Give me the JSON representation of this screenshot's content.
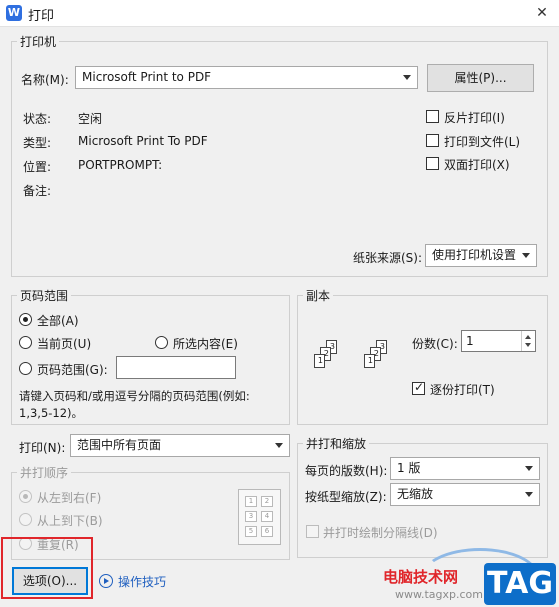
{
  "window": {
    "title": "打印",
    "app_icon": "wps-writer-icon"
  },
  "printer": {
    "group_label": "打印机",
    "name_label": "名称(M):",
    "name_value": "Microsoft Print to PDF",
    "properties_button": "属性(P)...",
    "status_label": "状态:",
    "status_value": "空闲",
    "type_label": "类型:",
    "type_value": "Microsoft Print To PDF",
    "location_label": "位置:",
    "location_value": "PORTPROMPT:",
    "comment_label": "备注:",
    "reverse_print": {
      "label": "反片打印(I)",
      "checked": false
    },
    "print_to_file": {
      "label": "打印到文件(L)",
      "checked": false
    },
    "duplex_print": {
      "label": "双面打印(X)",
      "checked": false
    },
    "paper_source_label": "纸张来源(S):",
    "paper_source_value": "使用打印机设置"
  },
  "page_range": {
    "group_label": "页码范围",
    "all_label": "全部(A)",
    "current_label": "当前页(U)",
    "selection_label": "所选内容(E)",
    "range_label": "页码范围(G):",
    "range_value": "",
    "selected": "all",
    "hint": "请键入页码和/或用逗号分隔的页码范围(例如:",
    "hint_line2": "1,3,5-12)。"
  },
  "copies": {
    "group_label": "副本",
    "count_label": "份数(C):",
    "count_value": "1",
    "collate_label": "逐份打印(T)",
    "collate_checked": true
  },
  "print_what": {
    "label": "打印(N):",
    "value": "范围中所有页面"
  },
  "combine_order": {
    "group_label": "并打顺序",
    "left_to_right": "从左到右(F)",
    "top_to_bottom": "从上到下(B)",
    "repeat": "重复(R)",
    "grid_numbers": [
      "1",
      "2",
      "3",
      "4",
      "5",
      "6"
    ]
  },
  "scale": {
    "group_label": "并打和缩放",
    "pages_per_sheet_label": "每页的版数(H):",
    "pages_per_sheet_value": "1 版",
    "scale_to_paper_label": "按纸型缩放(Z):",
    "scale_to_paper_value": "无缩放",
    "draw_borders_label": "并打时绘制分隔线(D)"
  },
  "footer": {
    "options_button": "选项(O)...",
    "tips_link": "操作技巧"
  },
  "watermark": {
    "site_name": "电脑技术网",
    "url": "www.tagxp.com",
    "logo_text": "TAG"
  },
  "colors": {
    "highlight_box": "#e0262b",
    "link": "#1f5fbf",
    "logo_bg": "#0d6ec9"
  }
}
